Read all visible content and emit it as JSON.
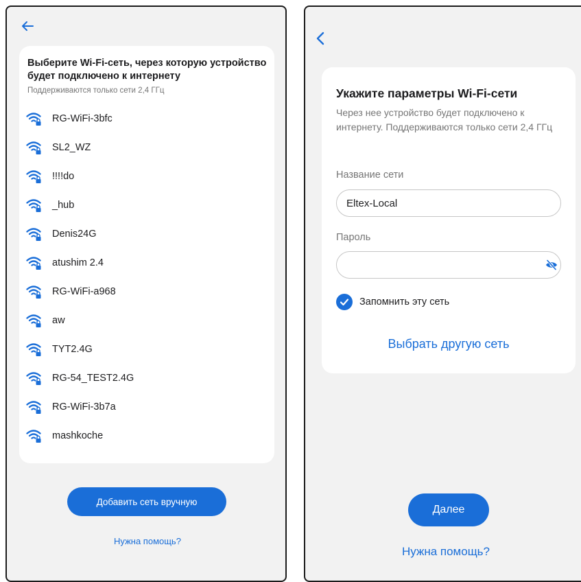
{
  "left": {
    "title": "Выберите Wi-Fi-сеть, через которую устройство будет подключено к интернету",
    "subtitle": "Поддерживаются только сети 2,4 ГГц",
    "networks": [
      "RG-WiFi-3bfc",
      "SL2_WZ",
      "!!!!do",
      "_hub",
      "Denis24G",
      "atushim 2.4",
      "RG-WiFi-a968",
      "aw",
      "TYT2.4G",
      "RG-54_TEST2.4G",
      "RG-WiFi-3b7a",
      "mashkoche"
    ],
    "network_icon": "wifi-lock-icon",
    "add_button": "Добавить сеть вручную",
    "help_link": "Нужна помощь?"
  },
  "right": {
    "title": "Укажите параметры Wi-Fi-сети",
    "description": "Через нее устройство будет подключено к интернету. Поддерживаются только сети 2,4 ГГц",
    "network_label": "Название сети",
    "network_value": "Eltex-Local",
    "password_label": "Пароль",
    "password_value": "",
    "remember_label": "Запомнить эту сеть",
    "remember_checked": true,
    "choose_other": "Выбрать другую сеть",
    "next_button": "Далее",
    "help_link": "Нужна помощь?"
  },
  "colors": {
    "accent": "#1a6ed8",
    "background": "#f2f2f2",
    "card": "#ffffff",
    "muted_text": "#757575"
  }
}
